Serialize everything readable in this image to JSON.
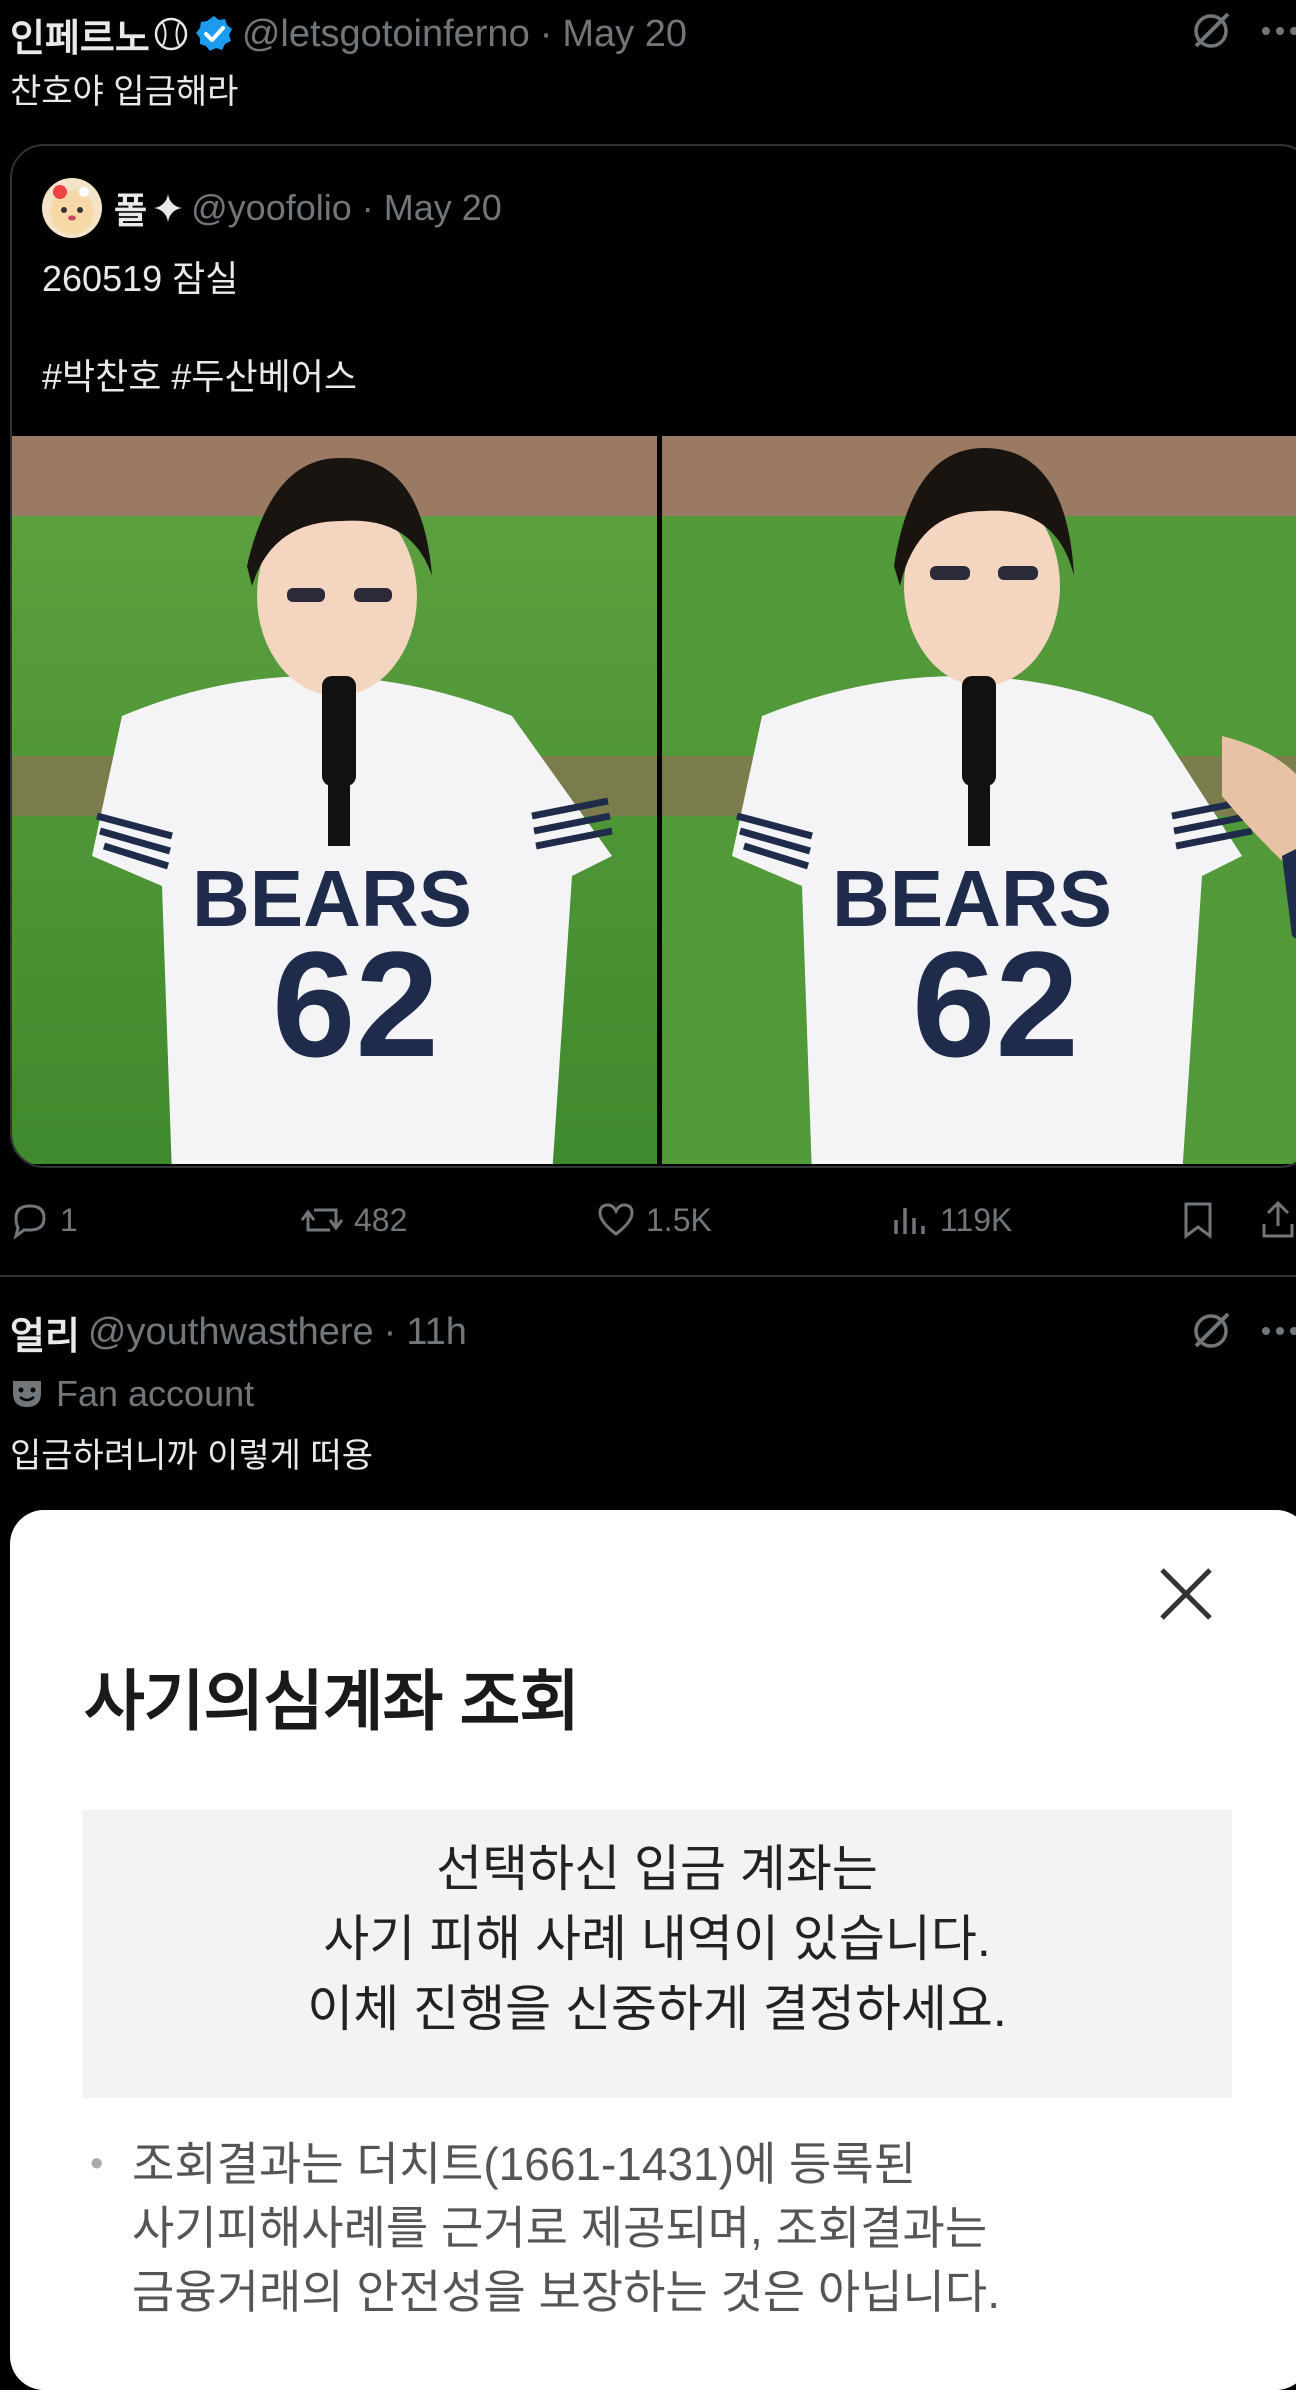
{
  "tweet1": {
    "display_name": "인페르노",
    "handle": "@letsgotoinferno",
    "separator": "·",
    "date": "May 20",
    "text": "찬호야 입금해라"
  },
  "quote": {
    "display_name": "폴",
    "handle": "@yoofolio",
    "separator": "·",
    "date": "May 20",
    "line1": "260519 잠실",
    "line2": "#박찬호 #두산베어스",
    "photo_jersey_text": "BEARS",
    "photo_jersey_number": "62"
  },
  "actions": {
    "replies": "1",
    "reposts": "482",
    "likes": "1.5K",
    "views": "119K"
  },
  "tweet2": {
    "display_name": "얼리",
    "handle": "@youthwasthere",
    "separator": "·",
    "time": "11h",
    "label": "Fan account",
    "text": "입금하려니까 이렇게 떠용"
  },
  "sheet": {
    "title": "사기의심계좌 조회",
    "warning_lines": [
      "선택하신 입금 계좌는",
      "사기 피해 사례 내역이 있습니다.",
      "이체 진행을 신중하게 결정하세요."
    ],
    "notice_lines": [
      "조회결과는 더치트(1661-1431)에 등록된",
      "사기피해사례를 근거로 제공되며, 조회결과는",
      "금융거래의 안전성을 보장하는 것은 아닙니다."
    ],
    "bullet": "•"
  },
  "colors": {
    "background": "#000000",
    "text": "#e7e9ea",
    "secondary": "#71767b",
    "verified": "#1d9bf0",
    "sheet_bg": "#ffffff",
    "warn_box": "#f2f3f5"
  }
}
